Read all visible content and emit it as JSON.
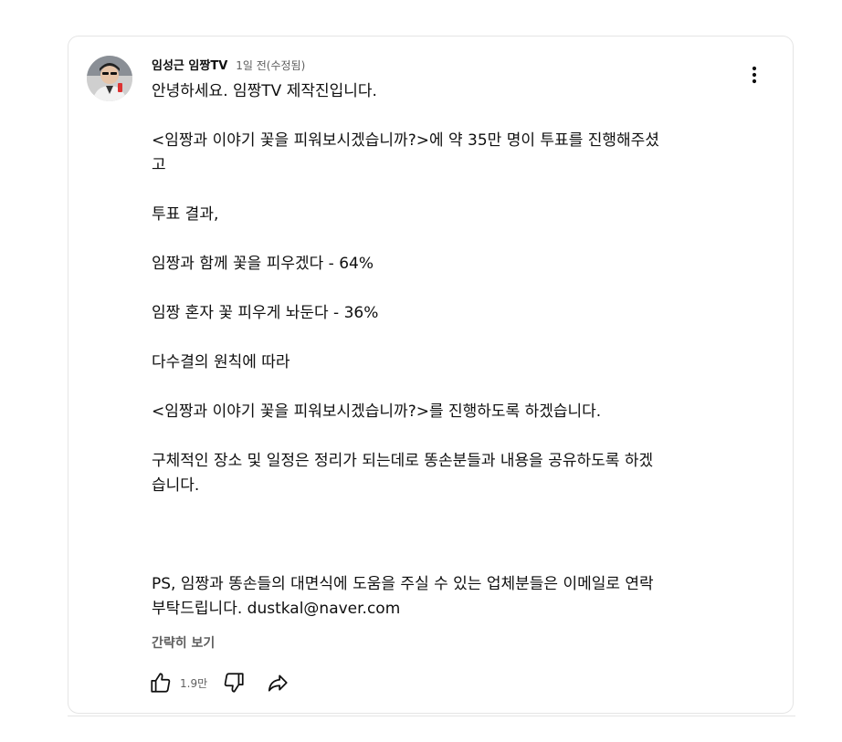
{
  "comment": {
    "author": "임성근 임짱TV",
    "time": "1일 전(수정됨)",
    "lines": [
      "안녕하세요. 임짱TV 제작진입니다.",
      "",
      "<임짱과 이야기 꽃을 피워보시겠습니까?>에 약 35만 명이 투표를 진행해주셨",
      "고",
      "",
      "투표 결과,",
      "",
      "임짱과 함께 꽃을 피우겠다 - 64%",
      "",
      "임짱 혼자 꽃 피우게 놔둔다 - 36%",
      "",
      "다수결의 원칙에 따라",
      "",
      "<임짱과 이야기 꽃을 피워보시겠습니까?>를 진행하도록 하겠습니다.",
      "",
      "구체적인 장소 및 일정은 정리가 되는데로 똥손분들과 내용을 공유하도록 하겠",
      "습니다.",
      "",
      "",
      "",
      "PS, 임짱과 똥손들의 대면식에 도움을 주실 수 있는 업체분들은 이메일로 연락",
      "부탁드립니다.  dustkal@naver.com"
    ],
    "read_less": "간략히 보기",
    "like_count": "1.9만",
    "icons": {
      "like": "thumbs-up-icon",
      "dislike": "thumbs-down-icon",
      "share": "share-icon",
      "menu": "more-vertical-icon"
    }
  }
}
